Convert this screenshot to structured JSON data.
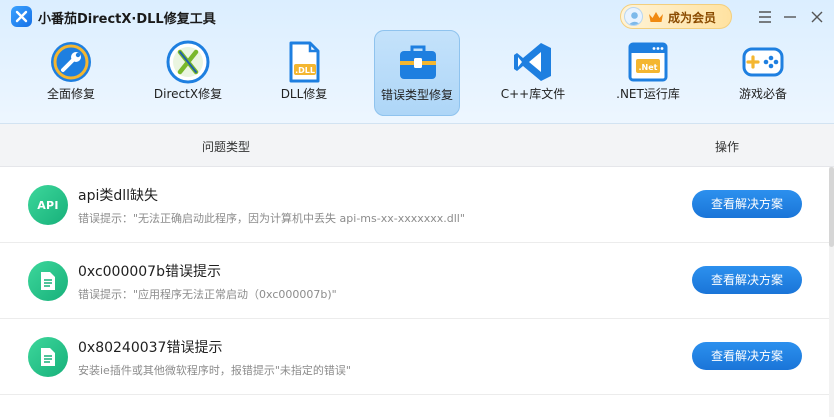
{
  "app": {
    "title": "小番茄DirectX·DLL修复工具"
  },
  "vip": {
    "label": "成为会员"
  },
  "tools": [
    {
      "label": "全面修复",
      "icon": "wrench-icon",
      "active": false
    },
    {
      "label": "DirectX修复",
      "icon": "directx-icon",
      "active": false
    },
    {
      "label": "DLL修复",
      "icon": "dll-file-icon",
      "active": false
    },
    {
      "label": "错误类型修复",
      "icon": "toolbox-icon",
      "active": true
    },
    {
      "label": "C++库文件",
      "icon": "visual-studio-icon",
      "active": false
    },
    {
      "label": ".NET运行库",
      "icon": "dotnet-window-icon",
      "active": false
    },
    {
      "label": "游戏必备",
      "icon": "gamepad-icon",
      "active": false
    }
  ],
  "table": {
    "header_type": "问题类型",
    "header_action": "操作"
  },
  "rows": [
    {
      "badge": "API",
      "title": "api类dll缺失",
      "desc": "错误提示：\"无法正确启动此程序，因为计算机中丢失 api-ms-xx-xxxxxxx.dll\"",
      "button": "查看解决方案"
    },
    {
      "badge": "",
      "title": "0xc000007b错误提示",
      "desc": "错误提示：\"应用程序无法正常启动（0xc000007b)\"",
      "button": "查看解决方案"
    },
    {
      "badge": "",
      "title": "0x80240037错误提示",
      "desc": "安装ie插件或其他微软程序时，报错提示\"未指定的错误\"",
      "button": "查看解决方案"
    }
  ],
  "colors": {
    "accent": "#1a75d8",
    "badge_green": "#17b07a",
    "active_tab": "#aed6f7"
  }
}
